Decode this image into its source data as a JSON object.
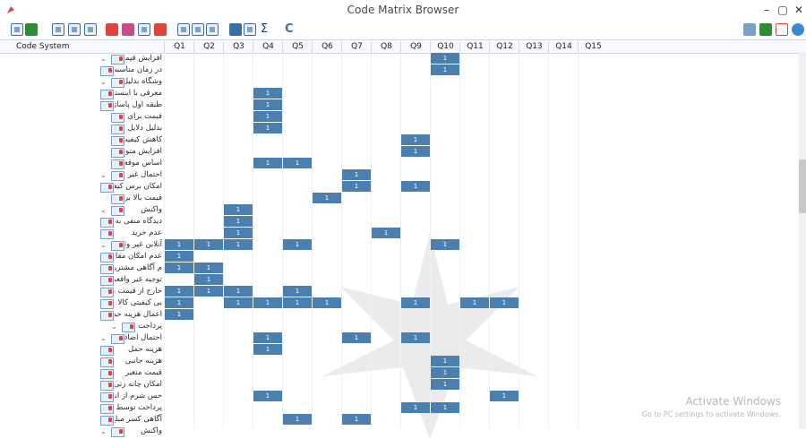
{
  "window": {
    "title": "Code Matrix Browser"
  },
  "header": {
    "label": "Code System",
    "columns": [
      "Q1",
      "Q2",
      "Q3",
      "Q4",
      "Q5",
      "Q6",
      "Q7",
      "Q8",
      "Q9",
      "Q10",
      "Q11",
      "Q12",
      "Q13",
      "Q14",
      "Q15"
    ]
  },
  "watermark": {
    "line1": "Activate Windows",
    "line2": "Go to PC settings to activate Windows."
  },
  "rows": [
    {
      "label": "افزایش قیمت با افزایش تقاضا",
      "indent": 1,
      "toggle": "⌄",
      "cells": [
        10
      ]
    },
    {
      "label": "در زمان مناسبت ها",
      "indent": 2,
      "cells": [
        10
      ]
    },
    {
      "label": "وشگاه بدلیل داشتن ویژگی متفاوت",
      "indent": 1,
      "toggle": "⌄",
      "cells": []
    },
    {
      "label": "معرفی با اینستاگرام",
      "indent": 2,
      "cells": [
        4
      ]
    },
    {
      "label": "طبقه اول پاساژ",
      "indent": 2,
      "cells": [
        4
      ]
    },
    {
      "label": "قیمت برای کالا با محدودیت مقداری",
      "indent": 1,
      "cells": [
        4
      ]
    },
    {
      "label": "بدلیل دلایل اقتصادی کشور- تحریم",
      "indent": 1,
      "cells": [
        4
      ]
    },
    {
      "label": "کاهش کیفیت در تولید بعدی",
      "indent": 1,
      "cells": [
        9
      ]
    },
    {
      "label": "افزایش متولی قیمت",
      "indent": 1,
      "cells": [
        9
      ]
    },
    {
      "label": "اساس موقعیت جغرافیایی فروشگاه",
      "indent": 1,
      "cells": [
        4,
        5
      ]
    },
    {
      "label": "احتمال غیر واقعی کمتر",
      "indent": 1,
      "toggle": "⌄",
      "cells": [
        7
      ]
    },
    {
      "label": "امکان برس کیفیت",
      "indent": 2,
      "cells": [
        7,
        9
      ]
    },
    {
      "label": "قیمت بالا برای کالای غیر برند",
      "indent": 1,
      "cells": [
        6
      ]
    },
    {
      "label": "واکنش",
      "indent": 1,
      "toggle": "⌄",
      "cells": [
        3
      ]
    },
    {
      "label": "دیدگاه منفی به سازمان",
      "indent": 2,
      "cells": [
        3
      ]
    },
    {
      "label": "عدم خرید",
      "indent": 2,
      "cells": [
        3,
        8
      ]
    },
    {
      "label": "آنلاین غیر واقعی تر از آنلاین",
      "indent": 1,
      "toggle": "⌄",
      "cells": [
        1,
        2,
        3,
        5,
        10
      ]
    },
    {
      "label": "عدم امکان مقایسه",
      "indent": 2,
      "cells": [
        1
      ]
    },
    {
      "label": "م آگاهی مشتریان به قیمت رقبا",
      "indent": 2,
      "cells": [
        1,
        2
      ]
    },
    {
      "label": "توجیه غیر واقعی فروشنده",
      "indent": 2,
      "cells": [
        2
      ]
    },
    {
      "label": "خارج از قیمت مرجع",
      "indent": 2,
      "cells": [
        1,
        2,
        3,
        5
      ]
    },
    {
      "label": "بی کیفیتی کالا",
      "indent": 2,
      "cells": [
        1,
        3,
        4,
        5,
        6,
        9,
        11,
        12
      ]
    },
    {
      "label": "اعمال هزینه حمل بر قیمت",
      "indent": 2,
      "cells": [
        1
      ]
    },
    {
      "label": "پرداخت اضافه",
      "indent": 0,
      "toggle": "⌄",
      "cells": []
    },
    {
      "label": "احتمال اضافه بیشتر از آنلاین",
      "indent": 1,
      "toggle": "⌄",
      "cells": [
        4,
        7,
        9
      ]
    },
    {
      "label": "هزینه حمل",
      "indent": 2,
      "cells": [
        4
      ]
    },
    {
      "label": "هزینه جانبی",
      "indent": 2,
      "cells": [
        10
      ]
    },
    {
      "label": "قیمت متغیر",
      "indent": 2,
      "cells": [
        10
      ]
    },
    {
      "label": "امکان چانه زنی",
      "indent": 2,
      "cells": [
        10
      ]
    },
    {
      "label": "حس شرم از انصراف خرید",
      "indent": 2,
      "cells": [
        4,
        12
      ]
    },
    {
      "label": "پرداخت توسط فروشنده",
      "indent": 2,
      "cells": [
        9,
        10
      ]
    },
    {
      "label": "آگاهی کسر مبلغ بعد از پرداخت",
      "indent": 2,
      "cells": [
        5,
        7
      ]
    },
    {
      "label": "واکنش",
      "indent": 1,
      "toggle": "⌄",
      "cells": []
    }
  ],
  "cell_text": "1",
  "colors": {
    "cell": "#4a7fb0",
    "header_bg": "#f7f9fc",
    "accent_red": "#e0453a",
    "accent_green": "#2e8b3a"
  },
  "toolbar": {
    "icons": [
      "tree-icon",
      "list-icon",
      "view1-icon",
      "view2-icon",
      "view3-icon",
      "code-red-icon",
      "code-red2-icon",
      "tree-sort-icon",
      "code-blue-icon",
      "grid1-icon",
      "grid2-icon",
      "grid3-icon",
      "doc-icon",
      "chart-icon",
      "sum-icon",
      "refresh-icon"
    ],
    "right_icons": [
      "camera-icon",
      "excel-icon",
      "export-icon",
      "info-icon"
    ],
    "sum_label": "Σ",
    "refresh_label": "C"
  }
}
